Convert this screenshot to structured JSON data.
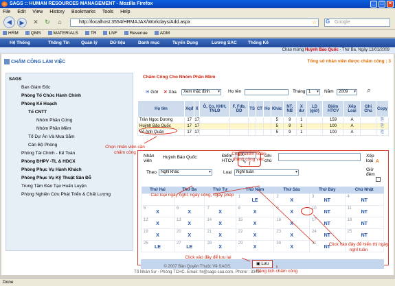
{
  "window": {
    "title": "SAGS :: HUMAN RESOURCES MANAGEMENT - Mozilla Firefox"
  },
  "menu": [
    "File",
    "Edit",
    "View",
    "History",
    "Bookmarks",
    "Tools",
    "Help"
  ],
  "nav": {
    "url": "http://localhost:3554/HRMAJAX/Workdays/Add.aspx",
    "search_placeholder": "Google"
  },
  "bookmarks": [
    "HRM",
    "QMS",
    "MATERIALS",
    "TR",
    "LNF",
    "Revenue",
    "ADM"
  ],
  "appnav": [
    "Hệ Thống",
    "Thông Tin",
    "Quản lý",
    "Dữ liệu",
    "Danh mục",
    "Tuyển Dụng",
    "Lương SAC",
    "Thống Kê"
  ],
  "greeting": {
    "prefix": "Chào mừng",
    "user": "Huỳnh Bảo Quốc",
    "date": "- Thứ Ba, Ngày 13/01/2009"
  },
  "page": {
    "title": "CHẤM CÔNG LÀM VIỆC",
    "pending_note": "Tổng số nhân viên được chấm công : 3"
  },
  "tree": [
    "SAGS",
    "Ban Giám Đốc",
    "Phòng Tổ Chức Hành Chính",
    "Phòng Kế Hoạch",
    "Tổ CNTT",
    "Nhóm Phần Cứng",
    "Nhóm Phần Mềm",
    "Tổ Dự Án Và Mua Sắm",
    "Cán Bộ Phòng",
    "Phòng Tài Chính - Kế Toán",
    "Phòng ĐHPV -TL & HDCX",
    "Phòng Phục Vụ Hành Khách",
    "Phòng Phục Vụ Kỹ Thuật Sân Đỗ",
    "Trung Tâm Đào Tạo Huấn Luyện",
    "Phòng Nghiên Cứu Phát Triển & Chất Lượng"
  ],
  "panel": {
    "title": "Chấm Công Cho Nhóm Phần Mềm",
    "toolbar": {
      "send": "Gửi",
      "delete": "Xóa",
      "default_view": "Xem mặc định",
      "name_label": "Họ tên",
      "month_label": "Tháng",
      "month": "1",
      "year_label": "Năm",
      "year": "2009"
    },
    "columns": [
      "Họ tên",
      "Xqđ",
      "X",
      "Ô, Co, KHH, TNLĐ",
      "F, Fdb, DD",
      "TS",
      "CT",
      "Ho",
      "Khác",
      "NT, NB",
      "X dư",
      "LD (giờ)",
      "Điểm HTCV",
      "Xếp Loại",
      "Ghi Chú",
      "Copy"
    ],
    "rows": [
      [
        "Trần Ngọc Dương",
        "17",
        "17",
        "",
        "",
        "",
        "",
        "",
        "5",
        "9",
        "1",
        "",
        "159",
        "A",
        "",
        ""
      ],
      [
        "Huỳnh Bảo Quốc",
        "17",
        "17",
        "",
        "",
        "",
        "",
        "",
        "5",
        "9",
        "1",
        "",
        "100",
        "A",
        "",
        ""
      ],
      [
        "Võ Anh Quân",
        "17",
        "17",
        "",
        "",
        "",
        "",
        "",
        "5",
        "9",
        "1",
        "",
        "100",
        "A",
        "",
        ""
      ]
    ]
  },
  "detail": {
    "employee_label": "Nhân viên",
    "employee": "Huỳnh Bảo Quốc",
    "score_label": "Điểm HTCV",
    "score": "100",
    "note_label": "Ghi chú",
    "rank_label": "Xếp loại",
    "rank": "A",
    "by_label": "Theo",
    "by_value": "Nghỉ khác",
    "type_label": "Loại",
    "type_value": "Nghỉ tuần",
    "late_label": "Giờ đêm",
    "weekdays": [
      "Thứ Hai",
      "Thứ Ba",
      "Thứ Tư",
      "Thứ Năm",
      "Thứ Sáu",
      "Thứ Bảy",
      "Chủ Nhật"
    ],
    "weeks": [
      [
        [
          "",
          ""
        ],
        [
          "",
          ""
        ],
        [
          "",
          ""
        ],
        [
          "1",
          "LE"
        ],
        [
          "2",
          "X"
        ],
        [
          "3",
          "NT"
        ],
        [
          "4",
          "NT"
        ]
      ],
      [
        [
          "5",
          "X"
        ],
        [
          "6",
          "X"
        ],
        [
          "7",
          "X"
        ],
        [
          "8",
          "X"
        ],
        [
          "9",
          "X"
        ],
        [
          "10",
          "NT"
        ],
        [
          "11",
          "NT"
        ]
      ],
      [
        [
          "12",
          "X"
        ],
        [
          "13",
          "X"
        ],
        [
          "14",
          "X"
        ],
        [
          "15",
          "X"
        ],
        [
          "16",
          "X"
        ],
        [
          "17",
          "NT"
        ],
        [
          "18",
          "NT"
        ]
      ],
      [
        [
          "19",
          "X"
        ],
        [
          "20",
          "X"
        ],
        [
          "21",
          "X"
        ],
        [
          "22",
          "X"
        ],
        [
          "23",
          "X"
        ],
        [
          "24",
          "NT"
        ],
        [
          "25",
          "NT"
        ]
      ],
      [
        [
          "26",
          "LE"
        ],
        [
          "27",
          "LE"
        ],
        [
          "28",
          "X"
        ],
        [
          "29",
          "X"
        ],
        [
          "30",
          "X"
        ],
        [
          "31",
          "NT"
        ],
        [
          "",
          ""
        ]
      ]
    ],
    "save": "Lưu"
  },
  "annotations": {
    "pick_employee": "Chọn nhân viên cần chấm công",
    "score": "Chấm điểm hoàn thành công việc",
    "leave_types": "Các loại ngày nghỉ, ngày công, ngày phép",
    "click_weekend": "Click vào đây để hiển thị ngày nghỉ tuần",
    "click_save": "Click vào đây để lưu lại",
    "timesheet": "Bảng lịch chấm công"
  },
  "footer": {
    "line1": "© 2007 Bản Quyền Thuộc Về SAGS.",
    "line2": "Tổ Nhân Sự - Phòng TCHC. Email: hr@sags-saa.com. Phone : 3349."
  },
  "status": "Done"
}
